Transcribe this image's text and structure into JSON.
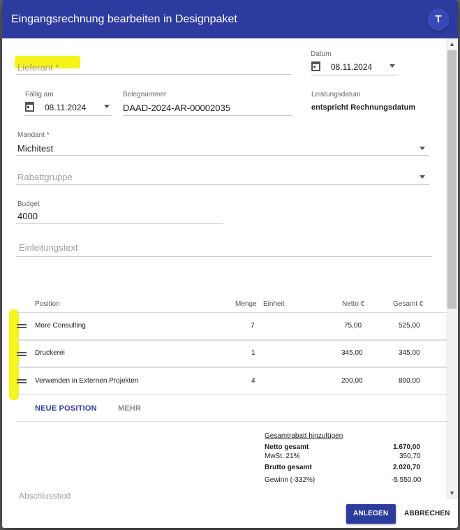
{
  "dialog": {
    "title": "Eingangsrechnung bearbeiten in Designpaket",
    "avatar_letter": "T"
  },
  "form": {
    "lieferant": {
      "label": "Lieferant *"
    },
    "datum": {
      "label": "Datum",
      "value": "08.11.2024"
    },
    "faellig": {
      "label": "Fällig am",
      "value": "08.11.2024"
    },
    "belegnummer": {
      "label": "Belegnummer",
      "value": "DAAD-2024-AR-00002035"
    },
    "leistungsdatum": {
      "label": "Leistungsdatum",
      "value": "entspricht Rechnungsdatum"
    },
    "mandant": {
      "label": "Mandant *",
      "value": "Michitest"
    },
    "rabattgruppe": {
      "placeholder": "Rabattgruppe"
    },
    "budget": {
      "label": "Budget",
      "value": "4000"
    },
    "einleitungstext": {
      "placeholder": "Einleitungstext"
    },
    "abschlusstext": {
      "placeholder": "Abschlusstext"
    }
  },
  "table": {
    "headers": {
      "position": "Position",
      "menge": "Menge",
      "einheit": "Einheit",
      "netto": "Netto €",
      "gesamt": "Gesamt €"
    },
    "rows": [
      {
        "position": "More Consulting",
        "menge": "7",
        "einheit": "",
        "netto": "75,00",
        "gesamt": "525,00"
      },
      {
        "position": "Druckerei",
        "menge": "1",
        "einheit": "",
        "netto": "345,00",
        "gesamt": "345,00"
      },
      {
        "position": "Verwenden in Externen Projekten",
        "menge": "4",
        "einheit": "",
        "netto": "200,00",
        "gesamt": "800,00"
      }
    ],
    "actions": {
      "new_position": "NEUE POSITION",
      "more": "MEHR"
    }
  },
  "summary": {
    "discount_link": "Gesamtrabatt hinzufügen",
    "netto_label": "Netto gesamt",
    "netto_value": "1.670,00",
    "mwst_label": "MwSt. 21%",
    "mwst_value": "350,70",
    "brutto_label": "Brutto gesamt",
    "brutto_value": "2.020,70",
    "gewinn_label": "Gewinn (-332%)",
    "gewinn_value": "-5.550,00"
  },
  "footer": {
    "create": "ANLEGEN",
    "cancel": "ABBRECHEN"
  },
  "colors": {
    "primary": "#2e3b9e",
    "highlight": "#f5f51c"
  }
}
